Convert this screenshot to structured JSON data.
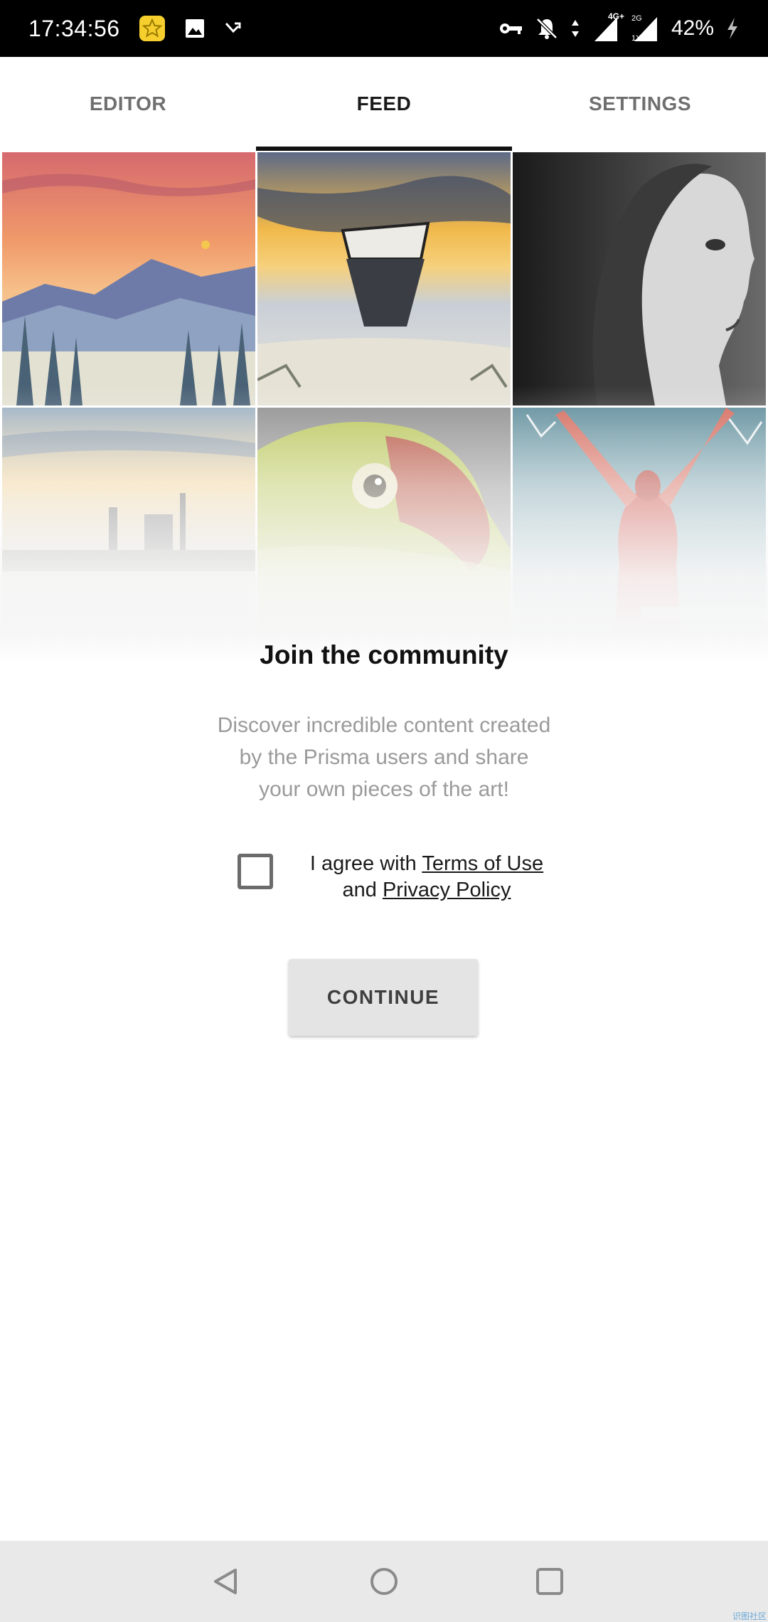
{
  "status_bar": {
    "time": "17:34:56",
    "network_labels": [
      "4G+",
      "2G",
      "1X"
    ],
    "battery": "42%",
    "icons": [
      "star-app-icon",
      "gallery-icon",
      "missed-call-icon",
      "vpn-key-icon",
      "bell-off-icon",
      "data-arrows-icon",
      "signal-icon",
      "signal-icon-2",
      "charging-icon"
    ]
  },
  "tabs": [
    {
      "label": "EDITOR",
      "active": false
    },
    {
      "label": "FEED",
      "active": true
    },
    {
      "label": "SETTINGS",
      "active": false
    }
  ],
  "gallery": {
    "tiles": [
      "sunset-mountains",
      "boat-on-lake",
      "woman-profile",
      "harbor-sunset",
      "parrot-closeup",
      "woman-arms-raised"
    ]
  },
  "content": {
    "title": "Join the community",
    "description_lines": [
      "Discover incredible content created",
      "by the Prisma users and share",
      "your own pieces of the art!"
    ],
    "agree_prefix": "I agree with ",
    "terms_link": "Terms of Use",
    "agree_middle": "and ",
    "privacy_link": "Privacy Policy",
    "checkbox_checked": false,
    "continue_label": "CONTINUE"
  },
  "nav_bar": {
    "buttons": [
      "back-icon",
      "home-icon",
      "recents-icon"
    ]
  },
  "watermark": "识图社区"
}
